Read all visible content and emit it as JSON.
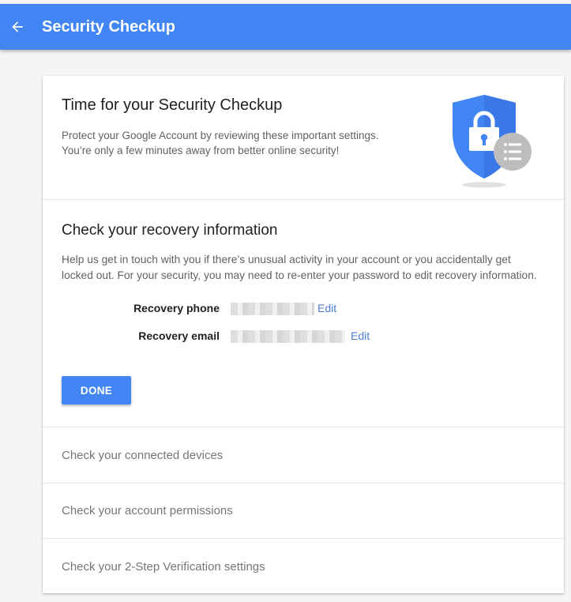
{
  "appbar": {
    "title": "Security Checkup",
    "back_icon": "arrow-left-icon",
    "color": "#4285f4"
  },
  "intro": {
    "title": "Time for your Security Checkup",
    "description_line1": "Protect your Google Account by reviewing these important settings.",
    "description_line2": "You’re only a few minutes away from better online security!",
    "illustration": "shield-lock-icon"
  },
  "recovery": {
    "title": "Check your recovery information",
    "description_line1": "Help us get in touch with you if there’s unusual activity in your account or you accidentally get",
    "description_line2": "locked out. For your security, you may need to re-enter your password to edit recovery information.",
    "phone_label": "Recovery phone",
    "email_label": "Recovery email",
    "edit_label": "Edit",
    "done_label": "DONE"
  },
  "checks": [
    {
      "label": "Check your connected devices"
    },
    {
      "label": "Check your account permissions"
    },
    {
      "label": "Check your 2-Step Verification settings"
    }
  ]
}
